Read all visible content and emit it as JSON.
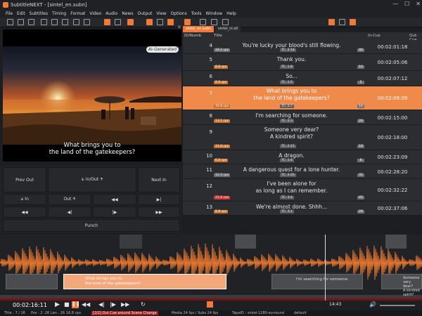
{
  "app": {
    "title": "SubtitleNEXT - [sintel_en.subn]",
    "window_controls": [
      "—",
      "☐",
      "✕"
    ]
  },
  "menu": [
    "File",
    "Edit",
    "Subtitles",
    "Timing",
    "Format",
    "Video",
    "Audio",
    "News",
    "Output",
    "View",
    "Options",
    "Tools",
    "Window",
    "Help"
  ],
  "video": {
    "badge": "AI-Generated",
    "subtitle_line1": "What brings you to",
    "subtitle_line2": "the land of the gatekeepers?"
  },
  "controls": {
    "prev_out": "Prev Out",
    "in_out": "🡫 In/Out 🡩",
    "next_in": "Next In",
    "in": "🡫 In",
    "out": "Out 🡩",
    "punch": "Punch"
  },
  "tabs": [
    "sintel_en.subn",
    "sintel_nl.stl"
  ],
  "grid_headers": {
    "id": "ID/Numb",
    "title": "Title",
    "in_cue": "In-Cue",
    "out_cue": "Out-Cue"
  },
  "rows": [
    {
      "num": "4",
      "l1": "You're lucky your blood's still flowing.",
      "l2": "",
      "cps": "18.2 cps",
      "cpsc": "g",
      "dur": "TC: 2:18",
      "in": "00:02:01:18",
      "sm": "40"
    },
    {
      "num": "5",
      "l1": "Thank you.",
      "l2": "",
      "cps": "8.8 cps",
      "cpsc": "o",
      "dur": "TC: 1:8",
      "in": "00:02:05:06",
      "sm": "10"
    },
    {
      "num": "6",
      "l1": "So...",
      "l2": "",
      "cps": "6.9 cps",
      "cpsc": "o",
      "dur": "TC: 1:5",
      "in": "00:02:07:12",
      "sm": "5"
    },
    {
      "num": "7",
      "l1": "What brings you to",
      "l2": "the land of the gatekeepers?",
      "cps": "16.8 cps",
      "cpsc": "o",
      "dur": "TC: 2:7",
      "in": "00:02:09:09",
      "sm": "18",
      "sel": true
    },
    {
      "num": "8",
      "l1": "I'm searching for someone.",
      "l2": "",
      "cps": "13.1 cps",
      "cpsc": "o",
      "dur": "TC: 2:3",
      "in": "00:02:15:00",
      "sm": "26"
    },
    {
      "num": "9",
      "l1": "Someone very dear?",
      "l2": "A kindred spirit?",
      "cps": "11.6 cps",
      "cpsc": "o",
      "dur": "TC: 2:15",
      "in": "00:02:18:00",
      "sm": "18"
    },
    {
      "num": "10",
      "l1": "A dragon.",
      "l2": "",
      "cps": "6.8 cps",
      "cpsc": "o",
      "dur": "TC: 1:4",
      "in": "00:02:23:09",
      "sm": "8"
    },
    {
      "num": "11",
      "l1": "A dangerous quest for a lone hunter.",
      "l2": "",
      "cps": "12.3 cps",
      "cpsc": "g",
      "dur": "TC: 2:20",
      "in": "00:02:28:20",
      "sm": "35"
    },
    {
      "num": "12",
      "l1": "I've been alone for",
      "l2": "as long as I can remember.",
      "cps": "15.9 cps",
      "cpsc": "r",
      "dur": "TC: 3:4",
      "in": "00:02:32:22",
      "sm": "45"
    },
    {
      "num": "13",
      "l1": "We're almost done. Shhh...",
      "l2": "",
      "cps": "8.8 cps",
      "cpsc": "o",
      "dur": "TC: 3:1",
      "in": "00:02:37:06",
      "sm": "26"
    }
  ],
  "waveform": {
    "clips": [
      {
        "t1": "What brings you to",
        "t2": "the land of the gatekeepers?"
      },
      {
        "t1": "I'm searching for someone.",
        "t2": ""
      },
      {
        "t1": "Someone very dear?",
        "t2": "A kindred spirit?"
      }
    ]
  },
  "timebar": {
    "timecode": "00:02:16:11",
    "marker": "14:43"
  },
  "status": {
    "title": "Title : 7 / 26",
    "pos": "Pos : 2 :26",
    "len": "Len : 26  16.8 cps",
    "warning": "[2/2] Out Cue around Scene Change",
    "media": "Media 24 fps / Subs 24 fps",
    "tape": "TapeID : sintel-1280-surround",
    "mode": "default"
  },
  "colors": {
    "accent": "#f07a3a",
    "bg": "#1c1e22"
  }
}
